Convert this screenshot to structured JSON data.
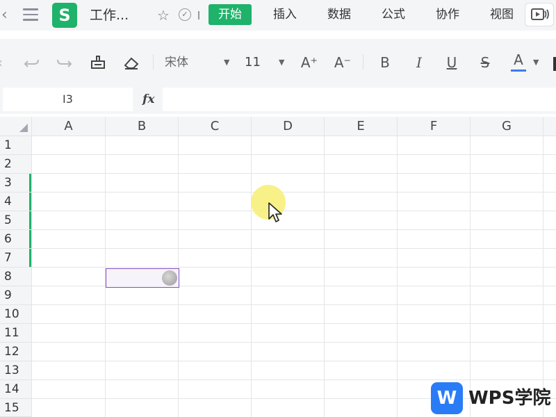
{
  "app": {
    "logo_letter": "S",
    "doc_title": "工作...",
    "tabs": [
      "开始",
      "插入",
      "数据",
      "公式",
      "协作",
      "视图"
    ],
    "active_tab": "开始"
  },
  "toolbar": {
    "font_name": "宋体",
    "font_size": "11",
    "increase_font_glyph": "A⁺",
    "decrease_font_glyph": "A⁻",
    "bold_glyph": "B",
    "italic_glyph": "I",
    "underline_glyph": "U",
    "strike_glyph": "S",
    "font_color_glyph": "A",
    "accent_color": "#3a7bf7"
  },
  "formula_bar": {
    "name_box": "I3",
    "fx_label": "fx",
    "formula_value": ""
  },
  "sheet": {
    "columns": [
      "A",
      "B",
      "C",
      "D",
      "E",
      "F",
      "G"
    ],
    "rows": [
      "1",
      "2",
      "3",
      "4",
      "5",
      "6",
      "7",
      "8",
      "9",
      "10",
      "11",
      "12",
      "13",
      "14",
      "15"
    ],
    "selected_rows": [
      "3",
      "4",
      "5",
      "6",
      "7"
    ],
    "active_cell": "B8"
  },
  "badge": {
    "logo_letter": "W",
    "text": "WPS学院"
  },
  "colors": {
    "brand_green": "#1fb26a",
    "selection_purple": "#7f4fc0",
    "wps_blue": "#2a7cf6"
  }
}
